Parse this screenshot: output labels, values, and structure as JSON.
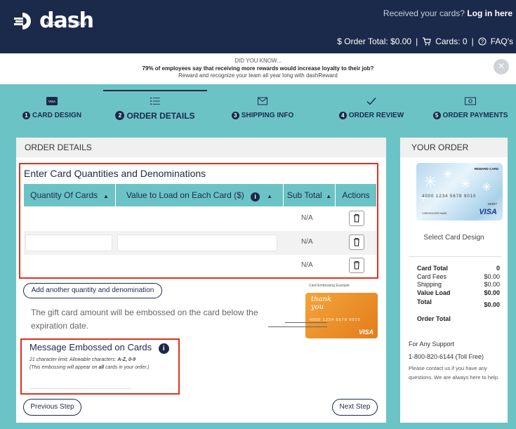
{
  "header": {
    "brand": "dash",
    "brand_sub": "SOLUTIONS",
    "received_text": "Received your cards?",
    "login_link": "Log in here",
    "order_total_label": "$ Order Total: $0.00",
    "cards_label": "Cards: 0",
    "faq_label": "FAQ's"
  },
  "banner": {
    "title": "DID YOU KNOW...",
    "fact": "79% of employees say that receiving more rewards would increase loyalty to their job?",
    "tagline": "Reward and recognize your team all year long with dashReward"
  },
  "steps": [
    {
      "num": "1",
      "label": "CARD DESIGN"
    },
    {
      "num": "2",
      "label": "ORDER DETAILS"
    },
    {
      "num": "3",
      "label": "SHIPPING INFO"
    },
    {
      "num": "4",
      "label": "ORDER REVIEW"
    },
    {
      "num": "5",
      "label": "ORDER PAYMENTS"
    }
  ],
  "order_details": {
    "panel_title": "ORDER DETAILS",
    "section_title": "Enter Card Quantities and Denominations",
    "columns": [
      "Quantity Of Cards",
      "Value to Load on Each Card ($)",
      "Sub Total",
      "Actions"
    ],
    "rows": [
      {
        "subtotal": "N/A"
      },
      {
        "subtotal": "N/A"
      },
      {
        "subtotal": "N/A"
      }
    ],
    "add_button": "Add another quantity and denomination",
    "emboss_note": "The gift card amount will be embossed on the card below the expiration date.",
    "example_label": "Card Embossing Example",
    "example_card_text": "thank you",
    "example_number": "4000 1234 5678 9010",
    "message_title": "Message Embossed on Cards",
    "message_rules": "21 character limit; Allowable characters: A-Z, 0-9",
    "message_rules_prefix": "21 character limit; Allowable characters: ",
    "message_rules_chars": "A-Z, 0-9",
    "message_scope_prefix": "(This embossing will appear on ",
    "message_scope_bold": "all",
    "message_scope_suffix": " cards in your order.)",
    "prev_button": "Previous Step",
    "next_button": "Next Step"
  },
  "your_order": {
    "panel_title": "YOUR ORDER",
    "card_number": "4000 1234 5678 9010",
    "card_name": "CARDHOLDER NAME",
    "card_brand": "VISA",
    "card_debit": "DEBIT",
    "card_reward": "REWARD CARD",
    "select_design": "Select Card Design",
    "card_total_label": "Card Total",
    "card_total_value": "0",
    "card_fees_label": "Card Fees",
    "card_fees_value": "$0.00",
    "shipping_label": "Shipping",
    "shipping_value": "$0.00",
    "value_load_label": "Value Load",
    "value_load_value": "$0.00",
    "total_label": "Total",
    "total_value": "$0.00",
    "order_total_label": "Order Total",
    "support_title": "For Any Support",
    "support_phone": "1-800-820-6144 (Toll Free)",
    "support_note": "Please contact us if you have any questions. We are always here to help."
  },
  "colors": {
    "navy": "#1b2a4a",
    "teal": "#6cc3c6",
    "highlight_red": "#e03020"
  }
}
